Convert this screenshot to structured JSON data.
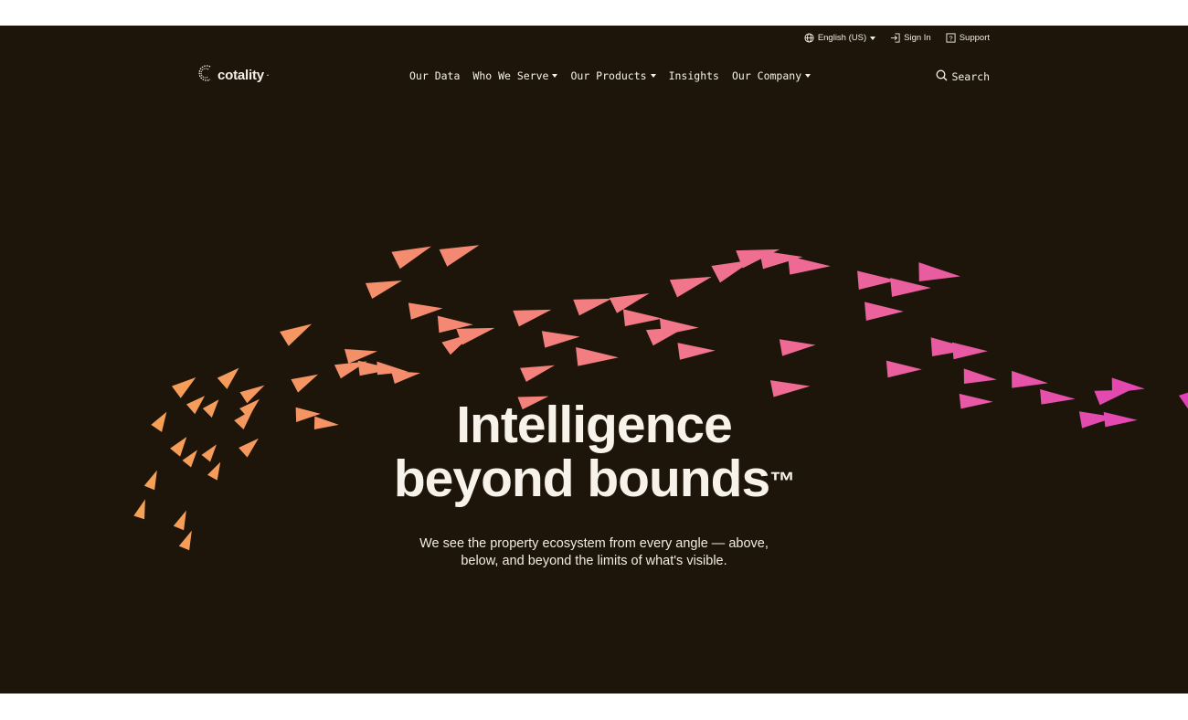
{
  "utility_bar": {
    "language": "English (US)",
    "sign_in": "Sign In",
    "support": "Support"
  },
  "brand": {
    "logo_text": "cotality",
    "logo_mark": "·"
  },
  "nav": {
    "items": [
      {
        "label": "Our Data",
        "has_dropdown": false
      },
      {
        "label": "Who We Serve",
        "has_dropdown": true
      },
      {
        "label": "Our Products",
        "has_dropdown": true
      },
      {
        "label": "Insights",
        "has_dropdown": false
      },
      {
        "label": "Our Company",
        "has_dropdown": true
      }
    ],
    "search_label": "Search"
  },
  "hero": {
    "headline_line1": "Intelligence",
    "headline_line2": "beyond bounds",
    "trademark": "™",
    "subheadline": "We see the property ecosystem from every angle — above, below, and beyond the limits of what's visible."
  },
  "colors": {
    "background": "#1d150a",
    "text": "#f6f1e8",
    "gradient_start": "#f6a253",
    "gradient_mid": "#f2778a",
    "gradient_end": "#e040b8"
  },
  "icons": [
    "globe-icon",
    "sign-in-icon",
    "support-icon",
    "search-icon"
  ]
}
